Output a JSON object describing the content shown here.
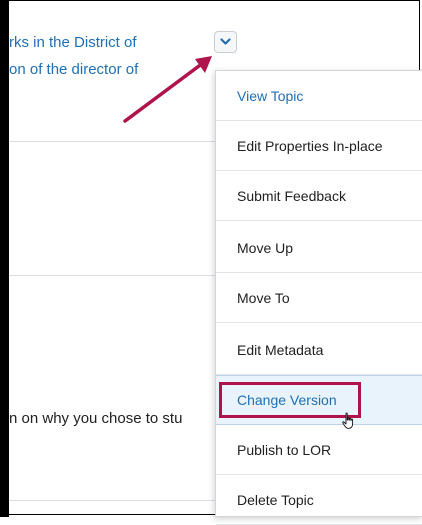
{
  "topic": {
    "lines": [
      "rks in the District of",
      "on of the director of"
    ]
  },
  "body": {
    "partial_text": "n on why you chose to stu"
  },
  "menu": {
    "items": [
      {
        "label": "View Topic"
      },
      {
        "label": "Edit Properties In-place"
      },
      {
        "label": "Submit Feedback"
      },
      {
        "label": "Move Up"
      },
      {
        "label": "Move To"
      },
      {
        "label": "Edit Metadata"
      },
      {
        "label": "Change Version"
      },
      {
        "label": "Publish to LOR"
      },
      {
        "label": "Delete Topic"
      }
    ],
    "selected_item": "Change Version"
  },
  "colors": {
    "link": "#1f6fb6",
    "annotation": "#b0124b",
    "highlight_bg": "#e8f3fb"
  },
  "icons": {
    "toggle": "chevron-down-icon",
    "pointer": "hand-pointer-icon",
    "annotation_arrow": "annotation-arrow-icon"
  }
}
